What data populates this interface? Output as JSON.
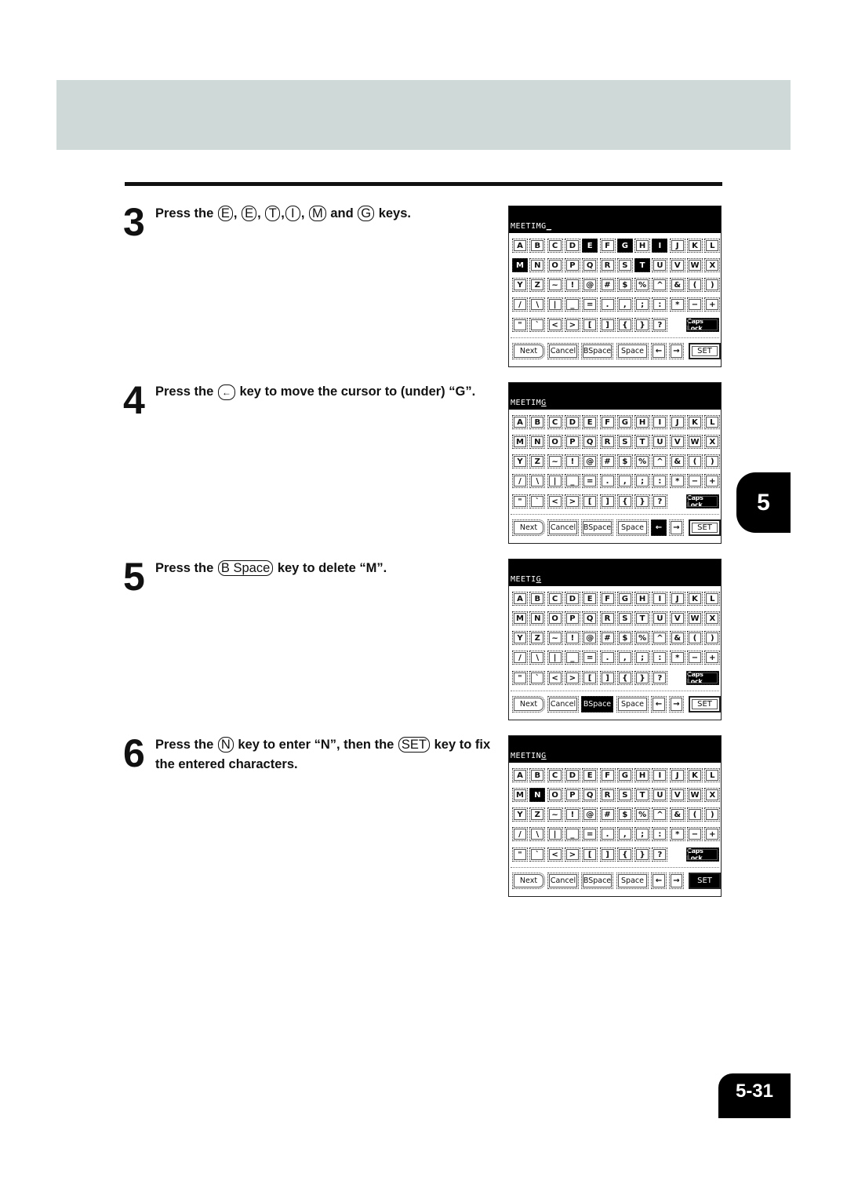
{
  "chapter_tab": "5",
  "page_number": "5-31",
  "steps": [
    {
      "number": "3",
      "parts": [
        "Press the ",
        {
          "key": "E"
        },
        ", ",
        {
          "key": "E"
        },
        ", ",
        {
          "key": "T"
        },
        ",",
        {
          "key": "I"
        },
        ", ",
        {
          "key": "M"
        },
        " and ",
        {
          "key": "G"
        },
        " keys."
      ]
    },
    {
      "number": "4",
      "parts": [
        "Press the ",
        {
          "key": "←",
          "icon": "left-arrow-icon"
        },
        " key to move the cursor to (under) “G”."
      ]
    },
    {
      "number": "5",
      "parts": [
        "Press the ",
        {
          "key": "B Space"
        },
        "  key to delete “M”."
      ]
    },
    {
      "number": "6",
      "parts": [
        "Press the ",
        {
          "key": "N"
        },
        " key to enter “N”, then the ",
        {
          "key": "SET"
        },
        "  key to fix the entered characters."
      ]
    }
  ],
  "keyboard": {
    "rows": [
      [
        "A",
        "B",
        "C",
        "D",
        "E",
        "F",
        "G",
        "H",
        "I",
        "J",
        "K",
        "L"
      ],
      [
        "M",
        "N",
        "O",
        "P",
        "Q",
        "R",
        "S",
        "T",
        "U",
        "V",
        "W",
        "X"
      ],
      [
        "Y",
        "Z",
        "~",
        "!",
        "@",
        "#",
        "$",
        "%",
        "^",
        "&",
        "(",
        ")"
      ],
      [
        "/",
        "\\",
        "|",
        "_",
        "=",
        ".",
        ",",
        ";",
        ":",
        "*",
        "−",
        "+"
      ],
      [
        "\"",
        "`",
        "<",
        ">",
        "[",
        "]",
        "{",
        "}",
        "?"
      ]
    ],
    "caps_lock": "Caps Lock",
    "bottom": {
      "next": "Next",
      "cancel": "Cancel",
      "bspace": "BSpace",
      "space": "Space",
      "left": "←",
      "right": "→",
      "set": "SET"
    }
  },
  "screens": [
    {
      "input_before": "MEETIMG",
      "input_cursor": "_",
      "input_after": "",
      "highlighted": [
        "E",
        "G",
        "I",
        "M",
        "T"
      ],
      "active_bottom": []
    },
    {
      "input_before": "MEETIM",
      "input_cursor": "G",
      "input_after": "",
      "highlighted": [],
      "active_bottom": [
        "left"
      ]
    },
    {
      "input_before": "MEETI",
      "input_cursor": "G",
      "input_after": "",
      "highlighted": [],
      "active_bottom": [
        "bspace"
      ]
    },
    {
      "input_before": "MEETIN",
      "input_cursor": "G",
      "input_after": "",
      "highlighted": [
        "N"
      ],
      "active_bottom": [
        "set"
      ]
    }
  ]
}
